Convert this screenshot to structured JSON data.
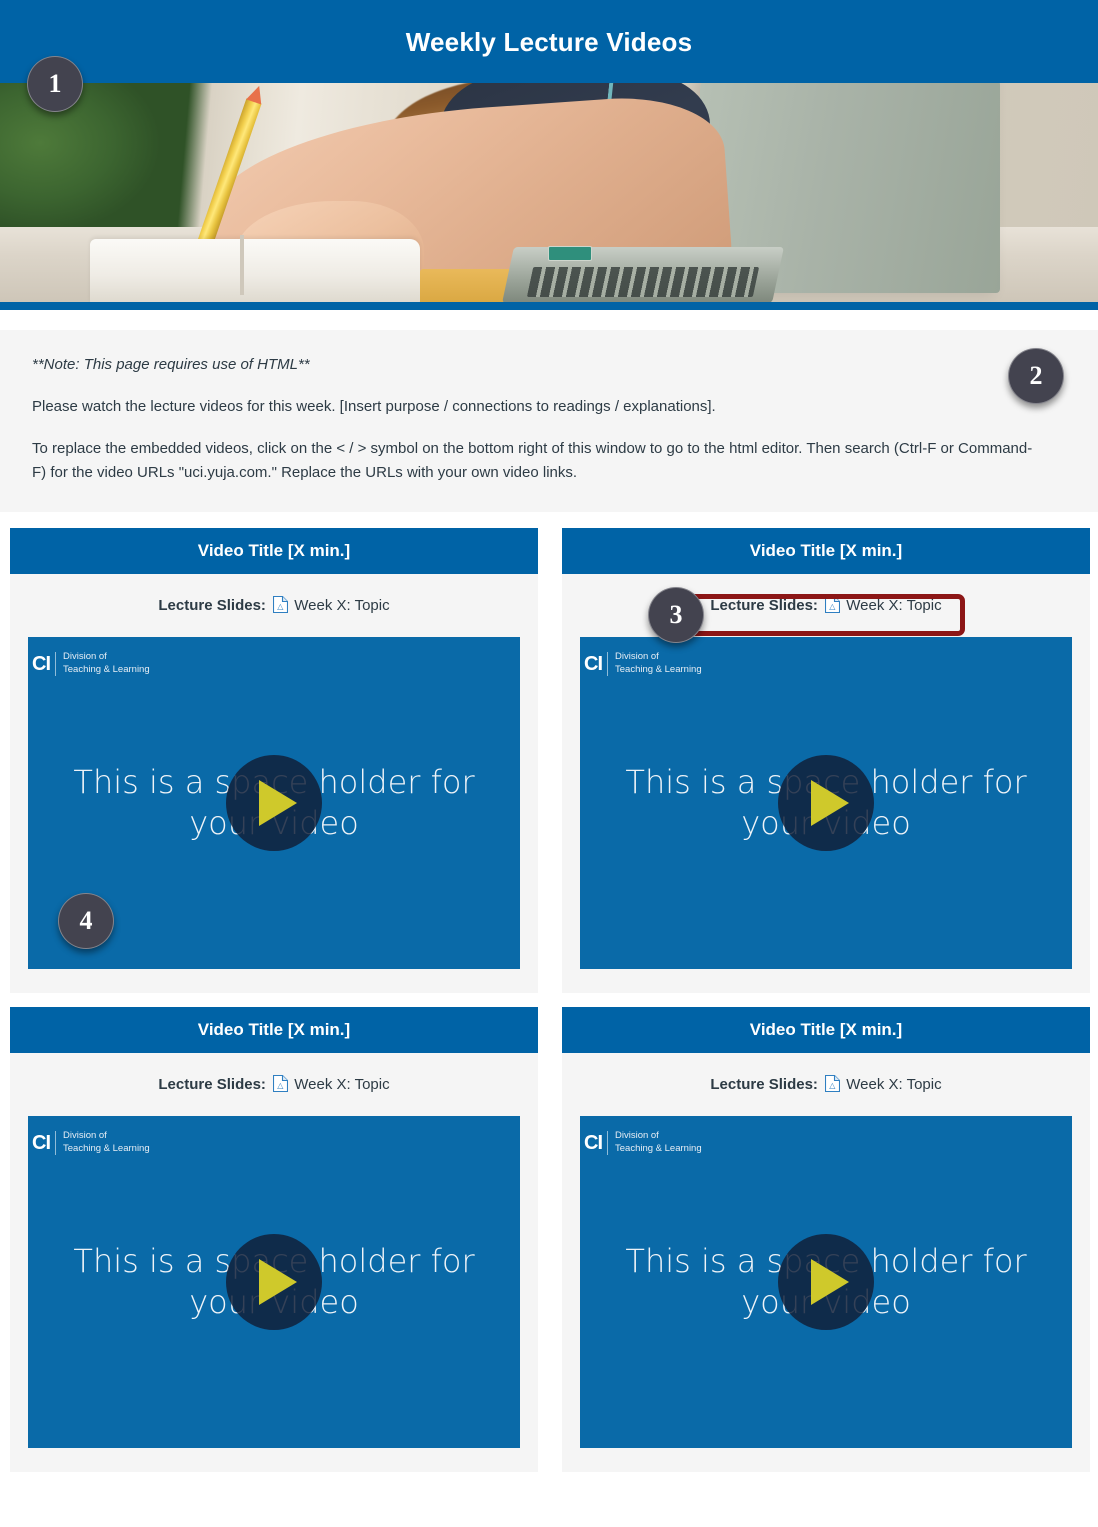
{
  "banner": {
    "title": "Weekly Lecture Videos",
    "photo_alt": "Student writing in a notebook with a pencil beside an open laptop",
    "background_color": "#0063a6"
  },
  "note": {
    "italic_note": "**Note: This page requires use of HTML**",
    "paragraph_1": "Please watch the lecture videos for this week. [Insert purpose / connections to readings / explanations].",
    "paragraph_2": "To replace the embedded videos, click on the < / > symbol on the bottom right of this window to go to the html editor. Then search (Ctrl-F or Command-F) for the video URLs \"uci.yuja.com.\" Replace the URLs with your own video links.",
    "background_color": "#f5f5f5"
  },
  "cards": [
    {
      "title": "Video Title [X min.]",
      "slides_label": "Lecture Slides:",
      "slides_link": "Week X: Topic",
      "pdf_icon": "pdf-file-icon",
      "video": {
        "logo_mark": "CI",
        "logo_line_1": "Division of",
        "logo_line_2": "Teaching & Learning",
        "caption": "This is a space holder for your video",
        "play_icon": "play-triangle-icon",
        "background_color": "#0a6aa8",
        "play_color": "#cfc92b"
      }
    },
    {
      "title": "Video Title [X min.]",
      "slides_label": "Lecture Slides:",
      "slides_link": "Week X: Topic",
      "pdf_icon": "pdf-file-icon",
      "video": {
        "logo_mark": "CI",
        "logo_line_1": "Division of",
        "logo_line_2": "Teaching & Learning",
        "caption": "This is a space holder for your video",
        "play_icon": "play-triangle-icon",
        "background_color": "#0a6aa8",
        "play_color": "#cfc92b"
      }
    },
    {
      "title": "Video Title [X min.]",
      "slides_label": "Lecture Slides:",
      "slides_link": "Week X: Topic",
      "pdf_icon": "pdf-file-icon",
      "video": {
        "logo_mark": "CI",
        "logo_line_1": "Division of",
        "logo_line_2": "Teaching & Learning",
        "caption": "This is a space holder for your video",
        "play_icon": "play-triangle-icon",
        "background_color": "#0a6aa8",
        "play_color": "#cfc92b"
      }
    },
    {
      "title": "Video Title [X min.]",
      "slides_label": "Lecture Slides:",
      "slides_link": "Week X: Topic",
      "pdf_icon": "pdf-file-icon",
      "video": {
        "logo_mark": "CI",
        "logo_line_1": "Division of",
        "logo_line_2": "Teaching & Learning",
        "caption": "This is a space holder for your video",
        "play_icon": "play-triangle-icon",
        "background_color": "#0a6aa8",
        "play_color": "#cfc92b"
      }
    }
  ],
  "annotations": {
    "badge_1": "1",
    "badge_2": "2",
    "badge_3": "3",
    "badge_4": "4",
    "badge_color": "#43434f",
    "highlight_color": "#8c1616"
  }
}
